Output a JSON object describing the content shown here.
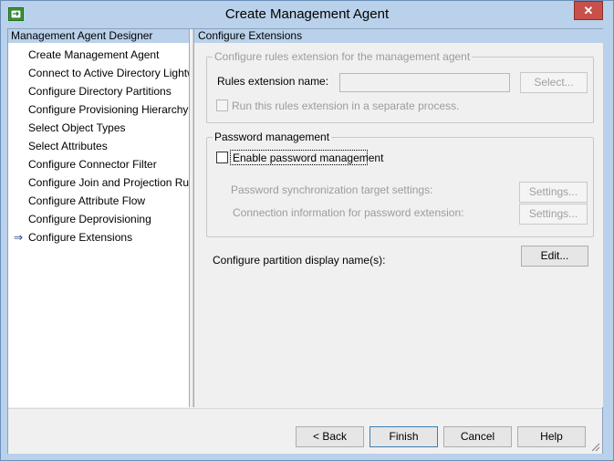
{
  "window": {
    "title": "Create Management Agent",
    "close_glyph": "✕"
  },
  "left_pane": {
    "header": "Management Agent Designer",
    "items": [
      {
        "label": "Create Management Agent",
        "current": false
      },
      {
        "label": "Connect to Active Directory Lightweig",
        "current": false
      },
      {
        "label": "Configure Directory Partitions",
        "current": false
      },
      {
        "label": "Configure Provisioning Hierarchy",
        "current": false
      },
      {
        "label": "Select Object Types",
        "current": false
      },
      {
        "label": "Select Attributes",
        "current": false
      },
      {
        "label": "Configure Connector Filter",
        "current": false
      },
      {
        "label": "Configure Join and Projection Rules",
        "current": false
      },
      {
        "label": "Configure Attribute Flow",
        "current": false
      },
      {
        "label": "Configure Deprovisioning",
        "current": false
      },
      {
        "label": "Configure Extensions",
        "current": true
      }
    ],
    "current_arrow": "⇒"
  },
  "right_pane": {
    "header": "Configure Extensions",
    "rules_group": {
      "legend": "Configure rules extension for the management agent",
      "name_label": "Rules extension name:",
      "name_value": "",
      "select_button": "Select...",
      "separate_process_label": "Run this rules extension in a separate process.",
      "separate_process_checked": false
    },
    "password_group": {
      "legend": "Password management",
      "enable_label": "Enable password management",
      "enable_checked": false,
      "sync_target_label": "Password synchronization target settings:",
      "sync_target_button": "Settings...",
      "connection_label": "Connection information for password extension:",
      "connection_button": "Settings..."
    },
    "partition_label": "Configure partition display name(s):",
    "edit_button": "Edit..."
  },
  "footer": {
    "back": "< Back",
    "finish": "Finish",
    "cancel": "Cancel",
    "help": "Help"
  },
  "icons": {
    "app": "management-agent-icon",
    "close": "close-icon",
    "arrow": "current-step-arrow-icon",
    "grip": "resize-grip-icon"
  }
}
